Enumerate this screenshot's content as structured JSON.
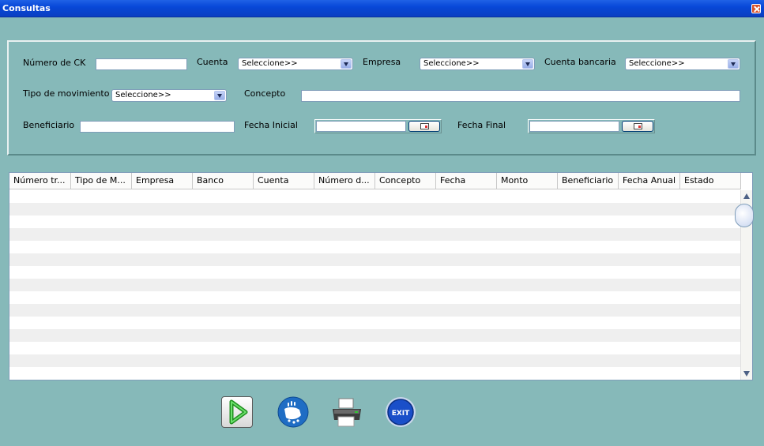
{
  "window": {
    "title": "Consultas"
  },
  "filters": {
    "numero_ck": {
      "label": "Número de CK",
      "value": ""
    },
    "cuenta": {
      "label": "Cuenta",
      "selected": "Seleccione>>"
    },
    "empresa": {
      "label": "Empresa",
      "selected": "Seleccione>>"
    },
    "cuenta_bancaria": {
      "label": "Cuenta bancaria",
      "selected": "Seleccione>>"
    },
    "tipo_movimiento": {
      "label": "Tipo de movimiento",
      "selected": "Seleccione>>"
    },
    "concepto": {
      "label": "Concepto",
      "value": ""
    },
    "beneficiario": {
      "label": "Beneficiario",
      "value": ""
    },
    "fecha_inicial": {
      "label": "Fecha Inicial",
      "value": ""
    },
    "fecha_final": {
      "label": "Fecha Final",
      "value": ""
    }
  },
  "table": {
    "columns": [
      "Número tr...",
      "Tipo de M...",
      "Empresa",
      "Banco",
      "Cuenta",
      "Número d...",
      "Concepto",
      "Fecha",
      "Monto",
      "Beneficiario",
      "Fecha Anual",
      "Estado"
    ],
    "rows": []
  },
  "actions": {
    "run": {
      "icon": "play-arrow-icon"
    },
    "clean": {
      "icon": "wash-hands-icon"
    },
    "print": {
      "icon": "printer-icon"
    },
    "exit": {
      "icon": "exit-icon",
      "label": "EXIT"
    }
  },
  "colors": {
    "background": "#86b9b9",
    "titlebar": "#0848d8",
    "accent_green": "#2bb42b",
    "exit_blue": "#1a4fc9"
  }
}
